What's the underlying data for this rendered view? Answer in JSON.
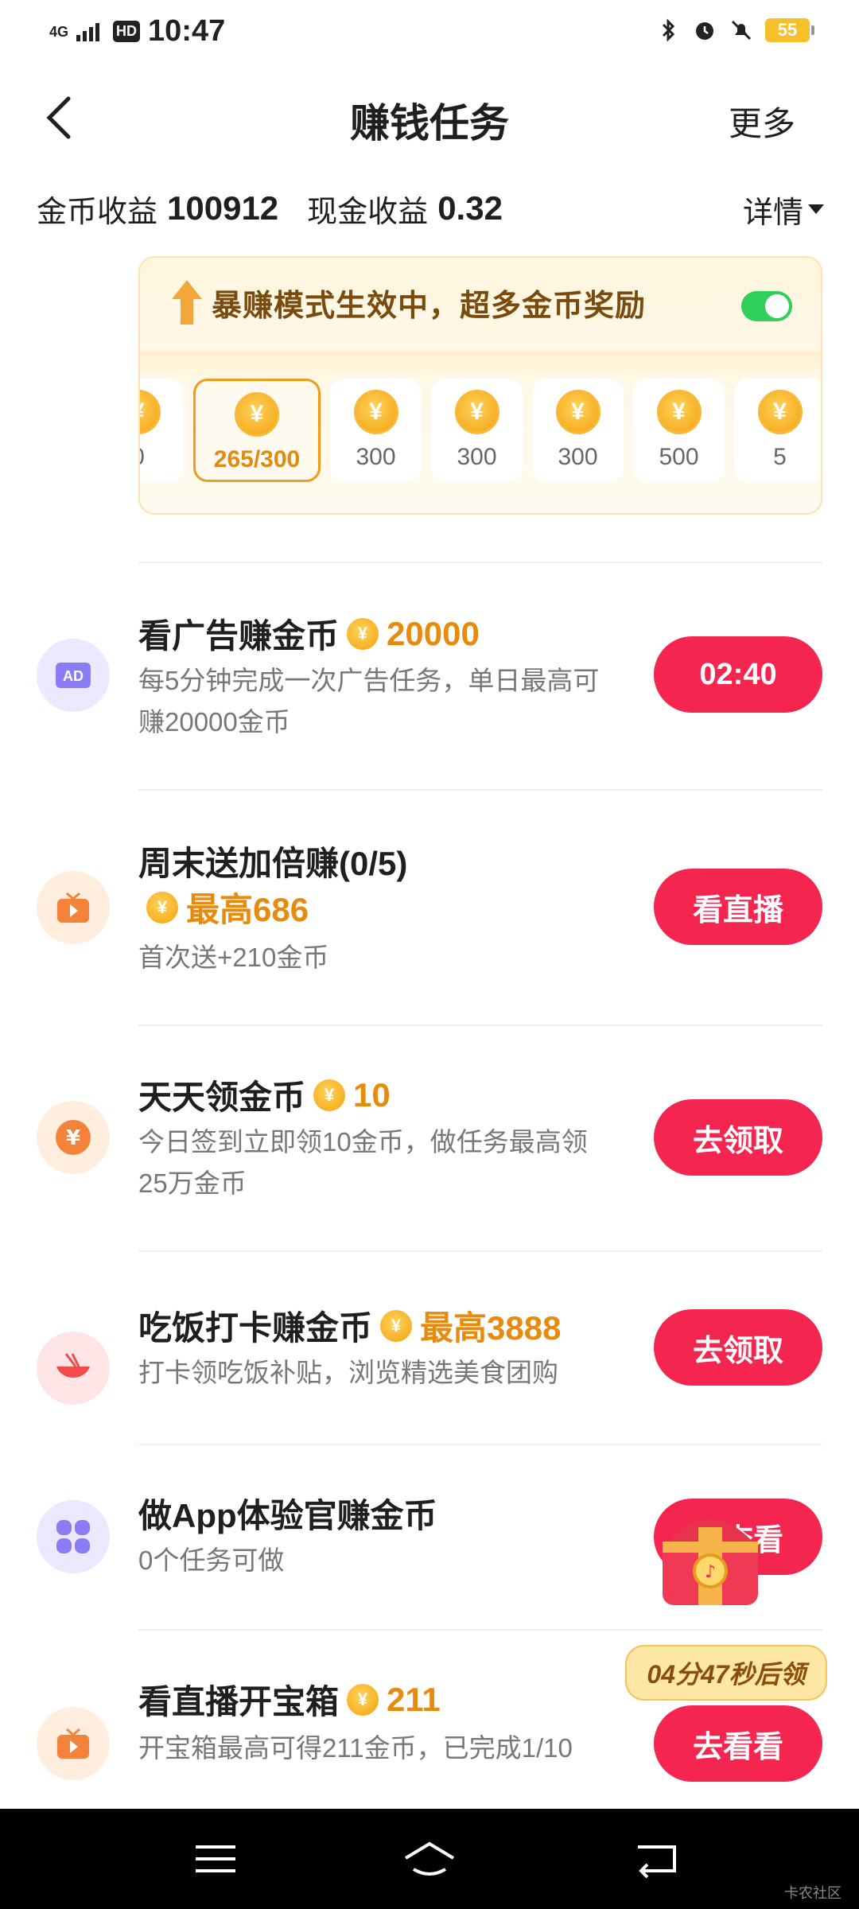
{
  "status_bar": {
    "signal": "4G",
    "hd": "HD",
    "time": "10:47",
    "battery": "55"
  },
  "nav": {
    "title": "赚钱任务",
    "more": "更多"
  },
  "earnings": {
    "coin_label": "金币收益",
    "coin_value": "100912",
    "cash_label": "现金收益",
    "cash_value": "0.32",
    "detail": "详情"
  },
  "boost": {
    "text": "暴赚模式生效中，超多金币奖励",
    "enabled": true,
    "rewards": [
      "0",
      "265/300",
      "300",
      "300",
      "300",
      "500",
      "5"
    ]
  },
  "tasks": [
    {
      "icon": "ad-icon",
      "name": "看广告赚金币",
      "reward": "20000",
      "desc": "每5分钟完成一次广告任务，单日最高可赚20000金币",
      "button": "02:40"
    },
    {
      "icon": "tv-icon",
      "name": "周末送加倍赚(0/5)",
      "reward": "最高686",
      "desc": "首次送+210金币",
      "button": "看直播"
    },
    {
      "icon": "yen-icon",
      "name": "天天领金币",
      "reward": "10",
      "desc": "今日签到立即领10金币，做任务最高领25万金币",
      "button": "去领取"
    },
    {
      "icon": "bowl-icon",
      "name": "吃饭打卡赚金币",
      "reward": "最高3888",
      "desc": "打卡领吃饭补贴，浏览精选美食团购",
      "button": "去领取"
    },
    {
      "icon": "clover-icon",
      "name": "做App体验官赚金币",
      "reward": "",
      "desc": "0个任务可做",
      "button": "去查看"
    },
    {
      "icon": "tv-icon",
      "name": "看直播开宝箱",
      "reward": "211",
      "desc": "开宝箱最高可得211金币，已完成1/10",
      "button": "去看看"
    }
  ],
  "chest": {
    "timer": "04分47秒后领"
  },
  "watermark": "卡农社区",
  "colors": {
    "accent": "#f4254e",
    "coin": "#f3a10f",
    "toggle": "#2fcf5a"
  }
}
